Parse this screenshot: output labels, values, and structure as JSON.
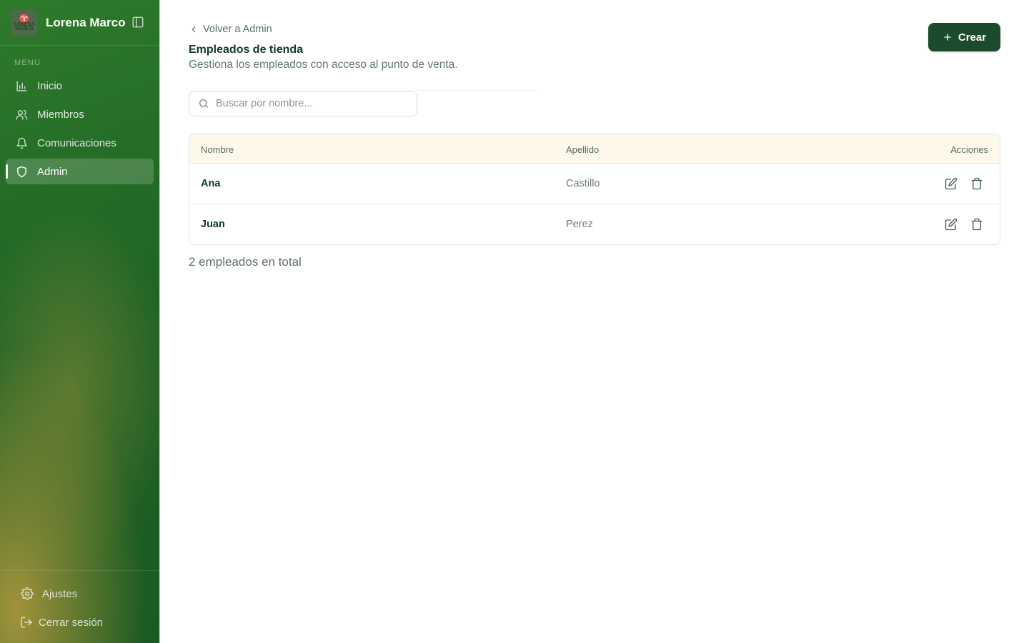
{
  "sidebar": {
    "brand": {
      "name": "Lorena Marco",
      "logo_text_1": "LORENA",
      "logo_text_2": "MARCO"
    },
    "menu_label": "MENU",
    "items": [
      {
        "label": "Inicio",
        "icon": "bar-chart-icon"
      },
      {
        "label": "Miembros",
        "icon": "users-icon"
      },
      {
        "label": "Comunicaciones",
        "icon": "bell-icon"
      },
      {
        "label": "Admin",
        "icon": "shield-icon",
        "active": true
      }
    ],
    "footer": {
      "settings_label": "Ajustes",
      "logout_label": "Cerrar sesión"
    }
  },
  "header": {
    "back_label": "Volver a Admin",
    "title": "Empleados de tienda",
    "subtitle": "Gestiona los empleados con acceso al punto de venta.",
    "create_label": "Crear"
  },
  "search": {
    "placeholder": "Buscar por nombre...",
    "value": ""
  },
  "table": {
    "columns": {
      "name": "Nombre",
      "last": "Apellido",
      "actions": "Acciones"
    },
    "rows": [
      {
        "name": "Ana",
        "last": "Castillo"
      },
      {
        "name": "Juan",
        "last": "Perez"
      }
    ]
  },
  "summary": {
    "total_label": "2 empleados en total"
  },
  "colors": {
    "accent": "#1b4b2c",
    "table_header_bg": "#fdf8e9",
    "sidebar_green": "#236a26"
  }
}
